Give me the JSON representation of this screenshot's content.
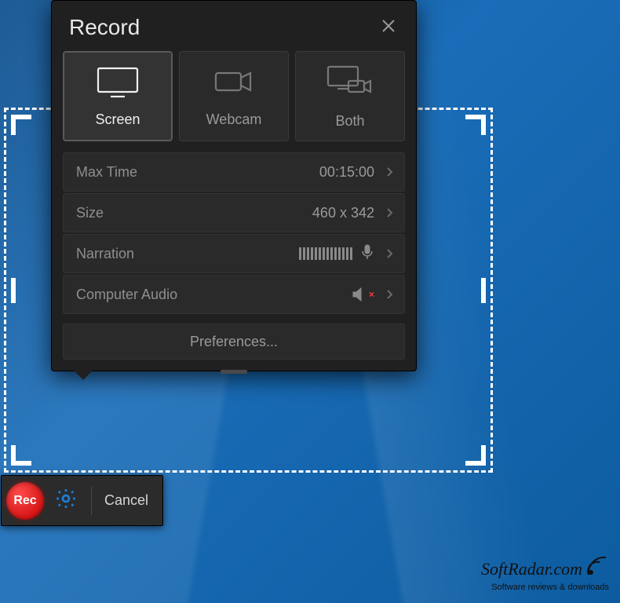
{
  "panel": {
    "title": "Record",
    "sources": [
      {
        "label": "Screen",
        "active": true
      },
      {
        "label": "Webcam",
        "active": false
      },
      {
        "label": "Both",
        "active": false
      }
    ],
    "settings": {
      "max_time": {
        "label": "Max Time",
        "value": "00:15:00"
      },
      "size": {
        "label": "Size",
        "value": "460 x 342"
      },
      "narration": {
        "label": "Narration"
      },
      "computer_audio": {
        "label": "Computer Audio",
        "muted": true
      }
    },
    "preferences_label": "Preferences..."
  },
  "toolbar": {
    "rec_label": "Rec",
    "cancel_label": "Cancel"
  },
  "watermark": {
    "brand": "SoftRadar.com",
    "tagline": "Software reviews & downloads"
  }
}
